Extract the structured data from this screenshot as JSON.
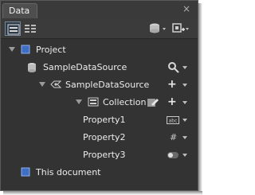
{
  "panel": {
    "title": "Data",
    "close_glyph": "×"
  },
  "toolbar": {
    "list_mode_icon": "list-view-icon",
    "details_mode_icon": "details-view-icon",
    "data_source_icon": "data-source-add-icon",
    "sample_data_icon": "sample-data-add-icon"
  },
  "tree": {
    "project": {
      "label": "Project"
    },
    "sample_data_source": {
      "label": "SampleDataSource"
    },
    "sample_data_source_child": {
      "label": "SampleDataSource",
      "action": "+"
    },
    "collection": {
      "label": "Collection",
      "action": "+"
    },
    "properties": [
      {
        "label": "Property1",
        "type_icon": "string-type-icon",
        "type_text": "abc"
      },
      {
        "label": "Property2",
        "type_icon": "number-type-icon",
        "type_text": "#"
      },
      {
        "label": "Property3",
        "type_icon": "boolean-type-icon"
      }
    ],
    "this_document": {
      "label": "This document"
    }
  },
  "colors": {
    "panel_bg": "#333333",
    "text": "#ececec",
    "accent_blue": "#4a78c8"
  }
}
